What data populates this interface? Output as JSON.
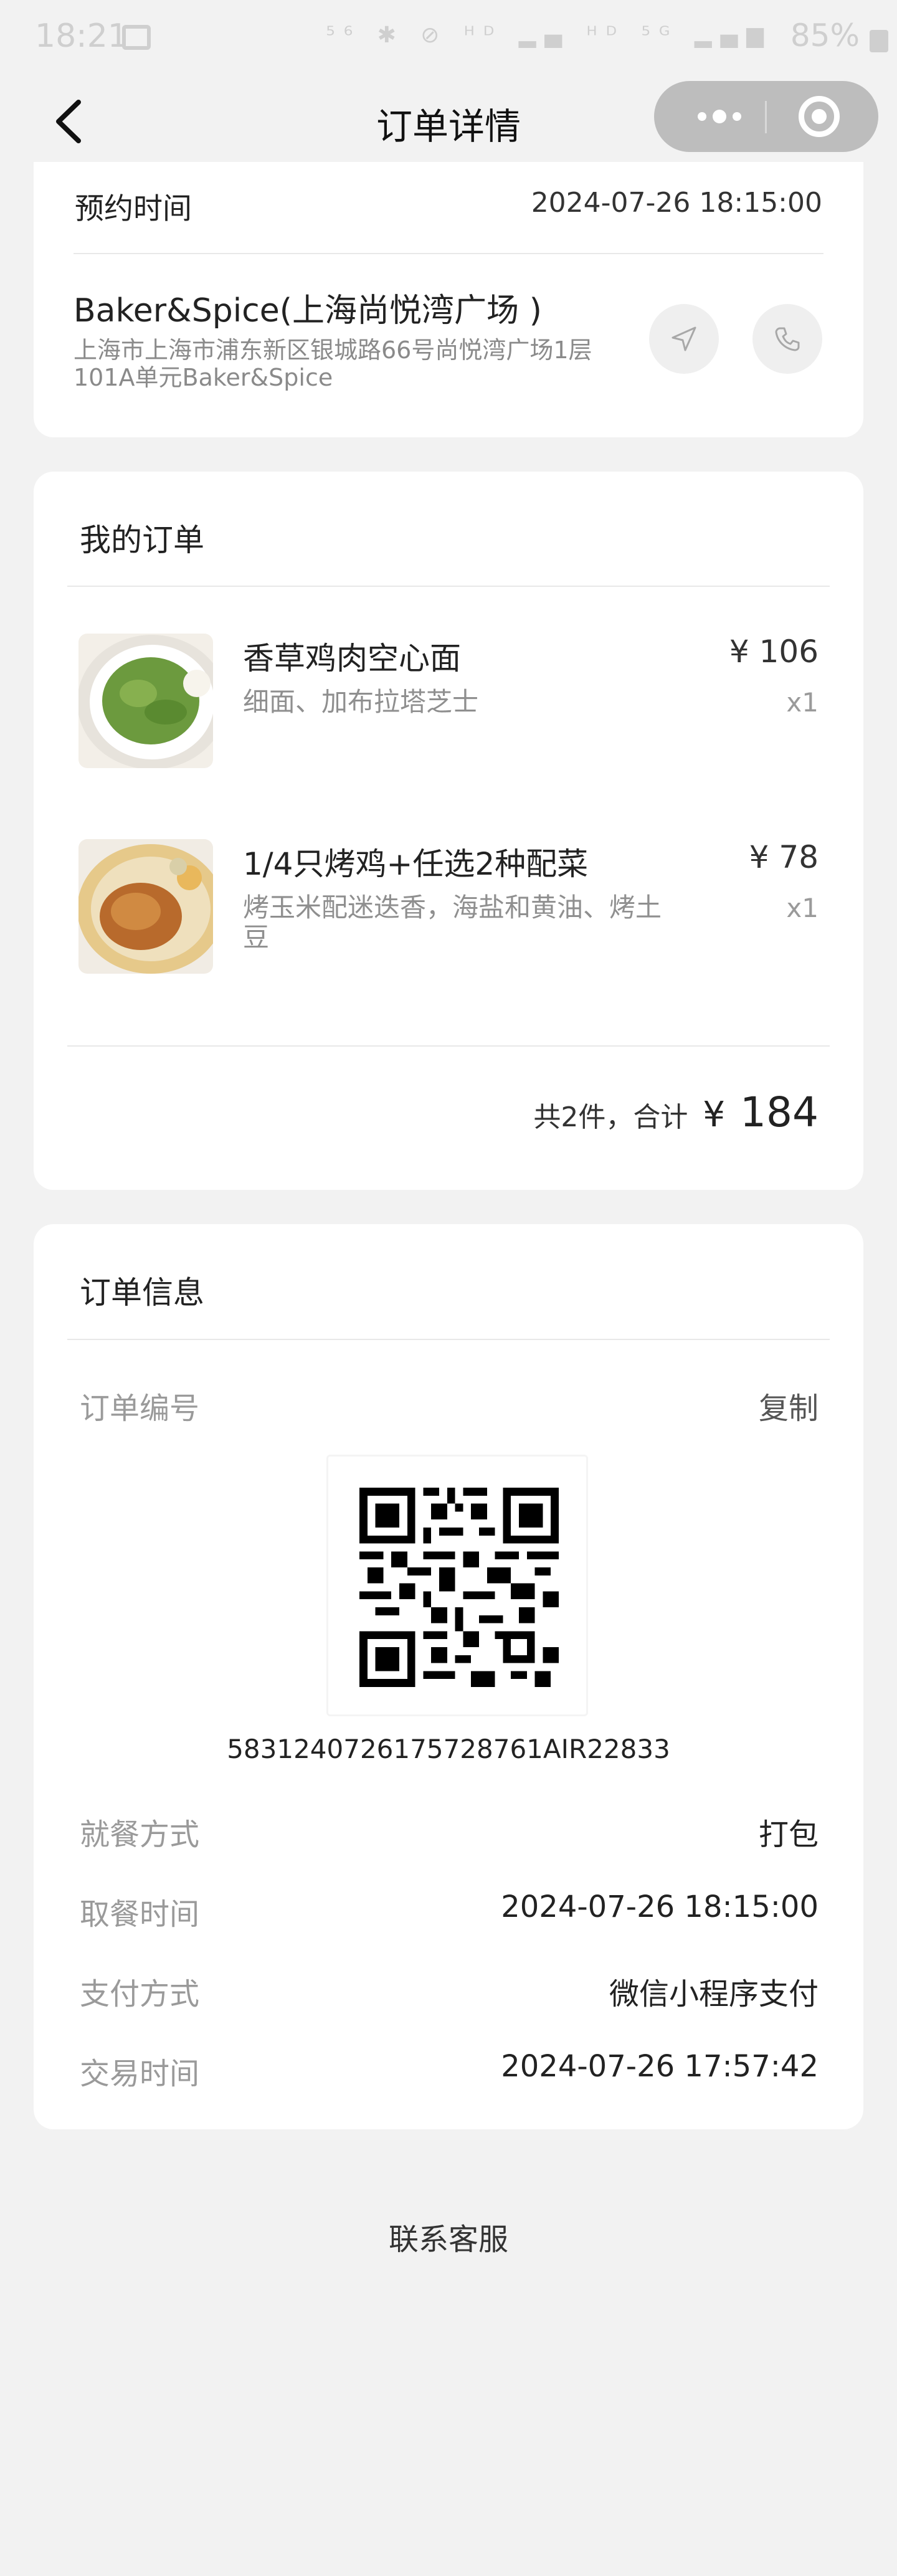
{
  "status_bar": {
    "time": "18:21",
    "network_icons": "⁵⁶ ✱ ⊘ ᴴᴰ ▂▄ ᴴᴰ ⁵ᴳ ▂▄▆",
    "battery": "85%"
  },
  "nav": {
    "title": "订单详情"
  },
  "store_card": {
    "appointment_label": "预约时间",
    "appointment_value": "2024-07-26 18:15:00",
    "store_name": "Baker&Spice(上海尚悦湾广场 )",
    "store_address": "上海市上海市浦东新区银城路66号尚悦湾广场1层101A单元Baker&Spice"
  },
  "order_card": {
    "title": "我的订单",
    "items": [
      {
        "name": "香草鸡肉空心面",
        "desc": "细面、加布拉塔芝士",
        "price": "¥ 106",
        "qty": "x1"
      },
      {
        "name": "1/4只烤鸡+任选2种配菜",
        "desc": "烤玉米配迷迭香，海盐和黄油、烤土豆",
        "price": "¥ 78",
        "qty": "x1"
      }
    ],
    "total_text": "共2件，合计",
    "total_yen": "¥",
    "total_amount": "184"
  },
  "info_card": {
    "title": "订单信息",
    "order_no_label": "订单编号",
    "copy_label": "复制",
    "order_number": "583124072617572876​1AIR22833",
    "rows": [
      {
        "label": "就餐方式",
        "value": "打包"
      },
      {
        "label": "取餐时间",
        "value": "2024-07-26 18:15:00"
      },
      {
        "label": "支付方式",
        "value": "微信小程序支付"
      },
      {
        "label": "交易时间",
        "value": "2024-07-26 17:57:42"
      }
    ]
  },
  "footer": {
    "contact_label": "联系客服"
  }
}
